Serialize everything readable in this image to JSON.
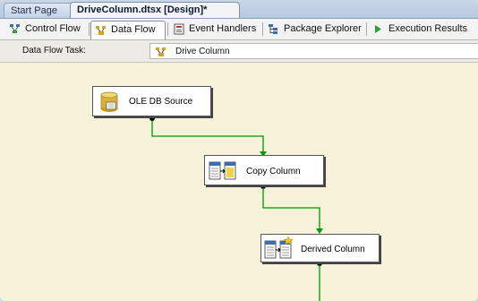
{
  "document_tabs": [
    {
      "label": "Start Page"
    },
    {
      "label": "DriveColumn.dtsx [Design]*"
    }
  ],
  "designer_tabs": [
    {
      "label": "Control Flow",
      "icon": "control-flow-icon"
    },
    {
      "label": "Data Flow",
      "icon": "data-flow-icon",
      "selected": true
    },
    {
      "label": "Event Handlers",
      "icon": "event-handlers-icon"
    },
    {
      "label": "Package Explorer",
      "icon": "package-explorer-icon"
    },
    {
      "label": "Execution Results",
      "icon": "execution-results-icon"
    }
  ],
  "task_bar": {
    "label": "Data Flow Task:",
    "value": "Drive Column",
    "icon": "data-flow-task-icon"
  },
  "components": [
    {
      "label": "OLE DB Source",
      "icon": "database-cylinder-icon"
    },
    {
      "label": "Copy Column",
      "icon": "copy-column-icon"
    },
    {
      "label": "Derived Column",
      "icon": "derived-column-icon"
    }
  ],
  "colors": {
    "canvas": "#f6f3da",
    "connector": "#009900",
    "tab_strip": "#c9d6e8"
  }
}
